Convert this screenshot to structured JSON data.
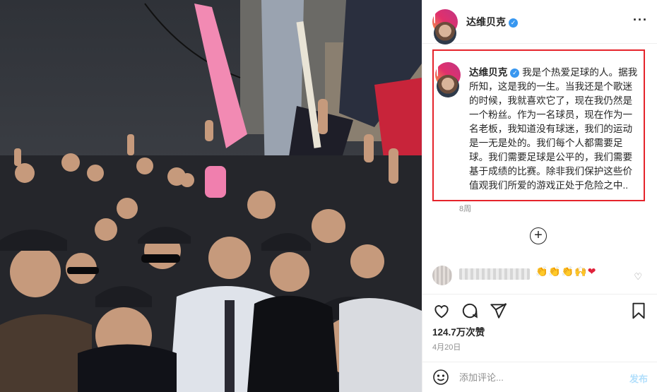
{
  "header": {
    "username": "达维贝克"
  },
  "caption": {
    "username": "达维贝克",
    "text": "我是个热爱足球的人。据我所知，这是我的一生。当我还是个歌迷的时候，我就喜欢它了，现在我仍然是一个粉丝。作为一名球员，现在作为一名老板，我知道没有球迷，我们的运动是一无是处的。我们每个人都需要足球。我们需要足球是公平的，我们需要基于成绩的比赛。除非我们保护这些价值观我们所爱的游戏正处于危险之中..",
    "age": "8周"
  },
  "comment": {
    "emoji": "👏👏👏🙌"
  },
  "stats": {
    "likes": "124.7万次赞",
    "date": "4月20日"
  },
  "add_comment": {
    "placeholder": "添加评论...",
    "post_label": "发布"
  },
  "icons": {
    "verified": "verified-badge-icon",
    "more": "more-options-icon",
    "load_more": "plus-circle-icon",
    "like": "heart-icon",
    "comment": "comment-icon",
    "share": "share-icon",
    "save": "bookmark-icon",
    "emoji": "smiley-icon"
  },
  "colors": {
    "verified": "#3897f0",
    "highlight_box": "#e5242b",
    "post_button": "#b2dffc",
    "secondary_text": "#8e8e8e"
  }
}
